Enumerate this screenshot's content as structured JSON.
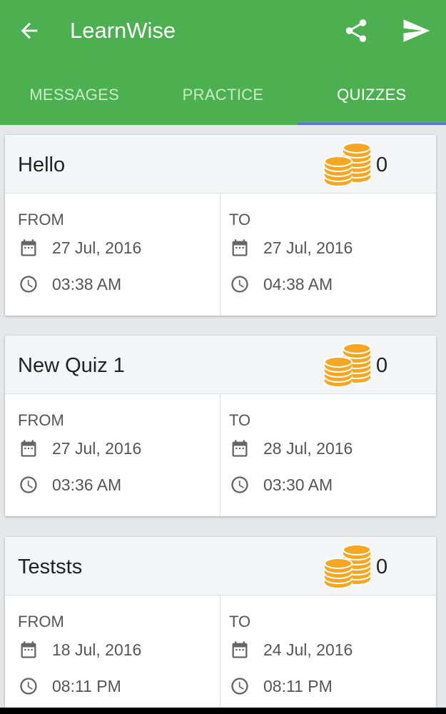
{
  "app": {
    "title": "LearnWise"
  },
  "tabs": [
    {
      "label": "MESSAGES",
      "active": false
    },
    {
      "label": "PRACTICE",
      "active": false
    },
    {
      "label": "QUIZZES",
      "active": true
    }
  ],
  "quizzes": [
    {
      "title": "Hello",
      "points": "0",
      "from": {
        "label": "FROM",
        "date": "27 Jul, 2016",
        "time": "03:38 AM"
      },
      "to": {
        "label": "TO",
        "date": "27 Jul, 2016",
        "time": "04:38 AM"
      }
    },
    {
      "title": "New Quiz 1",
      "points": "0",
      "from": {
        "label": "FROM",
        "date": "27 Jul, 2016",
        "time": "03:36 AM"
      },
      "to": {
        "label": "TO",
        "date": "28 Jul, 2016",
        "time": "03:30 AM"
      }
    },
    {
      "title": "Teststs",
      "points": "0",
      "from": {
        "label": "FROM",
        "date": "18 Jul, 2016",
        "time": "08:11 PM"
      },
      "to": {
        "label": "TO",
        "date": "24 Jul, 2016",
        "time": "08:11 PM"
      }
    }
  ],
  "colors": {
    "appbar": "#4caf50",
    "tab_indicator": "#5b6fe8",
    "coin": "#f5a623",
    "icon_gray": "#666666"
  },
  "icons": {
    "back": "arrow-back-icon",
    "share": "share-icon",
    "send": "send-icon",
    "coins": "coins-icon",
    "calendar": "calendar-icon",
    "clock": "clock-icon"
  }
}
